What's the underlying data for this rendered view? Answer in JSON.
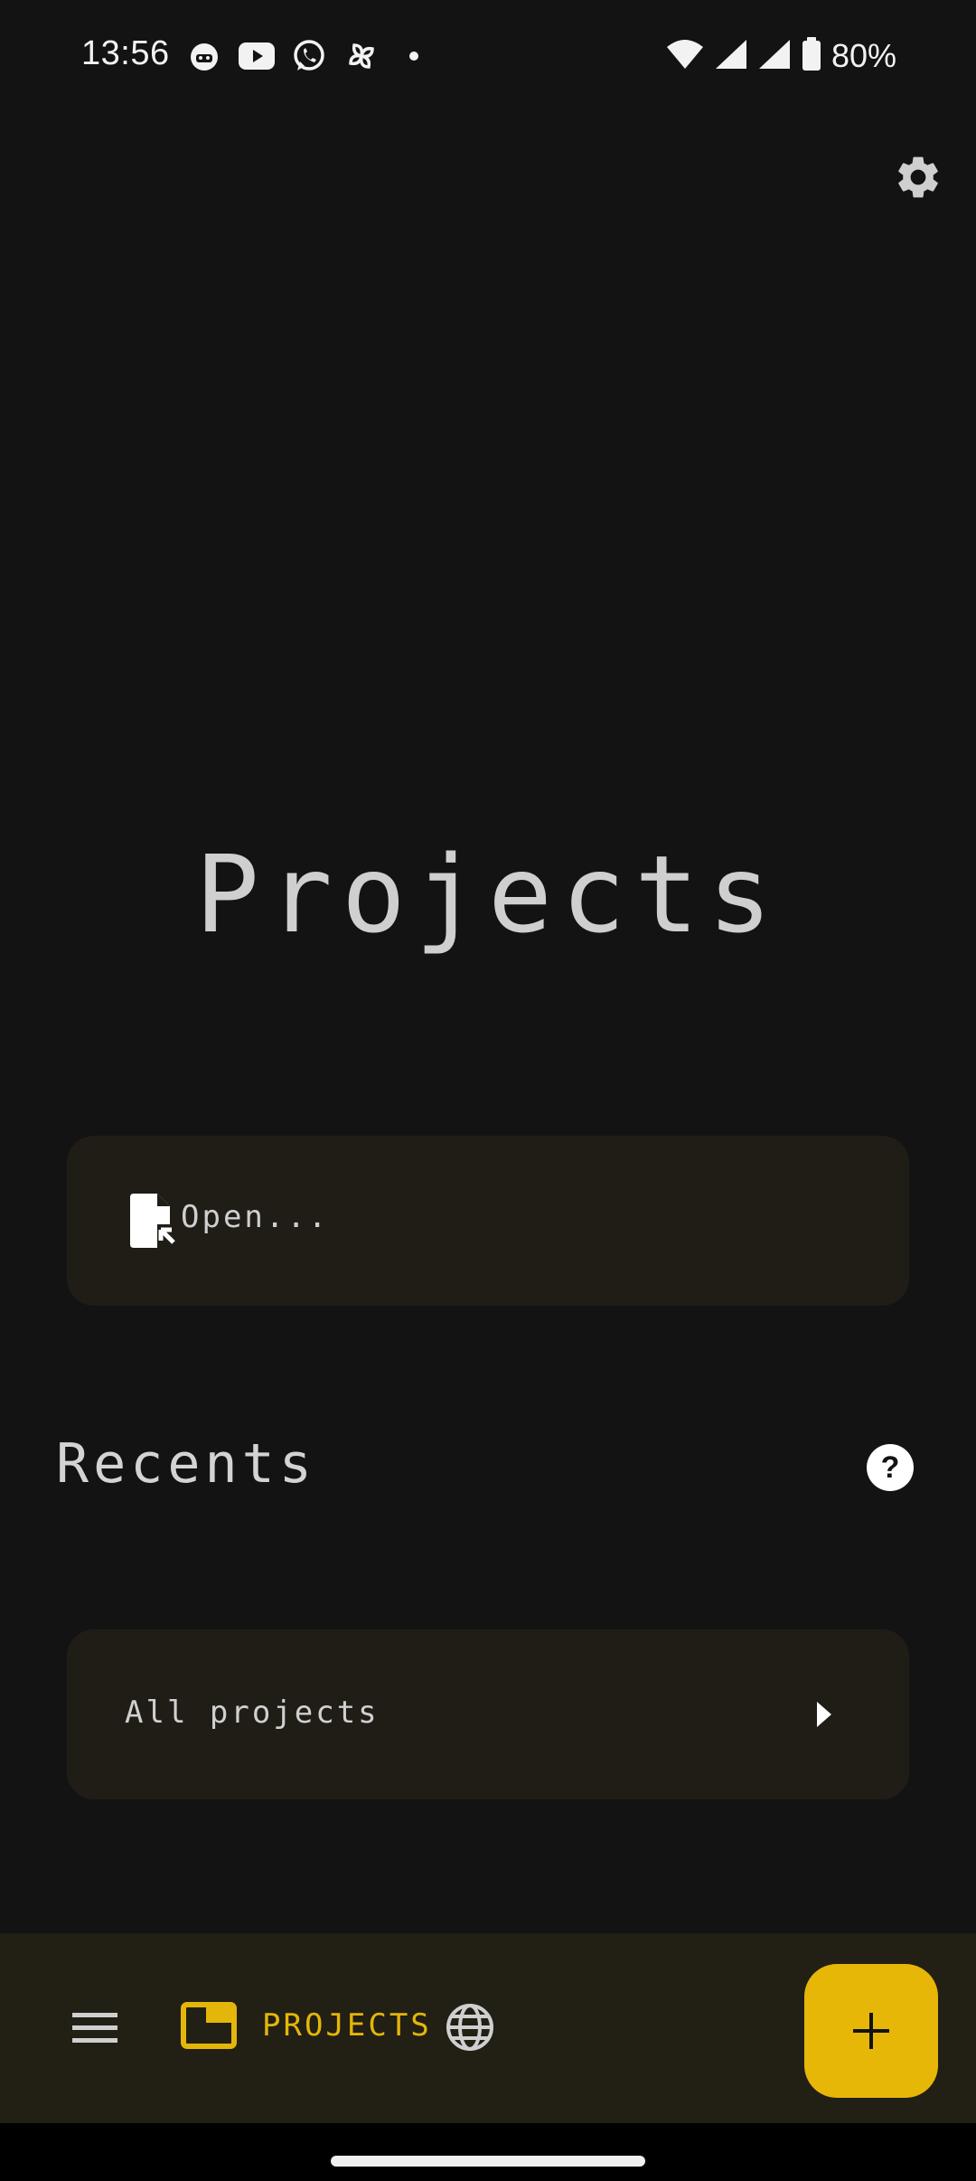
{
  "status_bar": {
    "time": "13:56",
    "battery_text": "80%",
    "icons_left": [
      "cat-app-icon",
      "youtube-icon",
      "whatsapp-icon",
      "pinwheel-app-icon",
      "dot-icon"
    ],
    "icons_right": [
      "wifi-icon",
      "signal-icon",
      "signal-icon-2",
      "battery-icon"
    ]
  },
  "header": {
    "title": "Projects",
    "settings_icon": "gear-icon"
  },
  "open_card": {
    "label": "Open...",
    "icon": "open-file-icon"
  },
  "recents": {
    "title": "Recents",
    "help_icon": "help-icon",
    "all_projects_label": "All projects",
    "chevron_icon": "chevron-right-icon"
  },
  "bottom_bar": {
    "menu_icon": "menu-icon",
    "projects_tab_label": "PROJECTS",
    "projects_tab_icon": "folder-icon",
    "globe_icon": "globe-icon",
    "fab_icon": "plus-icon"
  },
  "colors": {
    "background": "#131313",
    "card": "#201d17",
    "bottom_bar": "#221f15",
    "accent": "#e7b708",
    "text": "#cfcfcf"
  }
}
